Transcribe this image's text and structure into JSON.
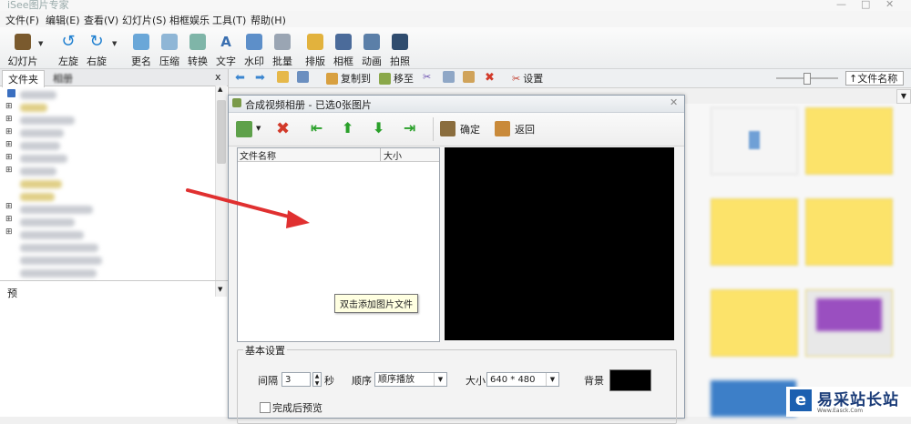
{
  "app": {
    "title": "iSee图片专家"
  },
  "menu": [
    "文件(F)",
    "编辑(E)",
    "查看(V)",
    "幻灯片(S)",
    "相框娱乐",
    "工具(T)",
    "帮助(H)"
  ],
  "toolbar": [
    "幻灯片",
    "左旋",
    "右旋",
    "更名",
    "压缩",
    "转换",
    "文字",
    "水印",
    "批量",
    "排版",
    "相框",
    "动画",
    "拍照"
  ],
  "navbar": {
    "copy_to": "复制到",
    "move_to": "移至",
    "settings": "设置",
    "sort": "↑文件名称"
  },
  "left_panel": {
    "tab_folder": "文件夹",
    "tab_album": "相册",
    "pane_close": "x",
    "preview_label": "预"
  },
  "dialog": {
    "title": "合成视频相册 - 已选0张图片",
    "toolbar": {
      "confirm": "确定",
      "back": "返回"
    },
    "file_list": {
      "col_name": "文件名称",
      "col_size": "大小"
    },
    "tooltip": "双击添加图片文件",
    "settings": {
      "group_title": "基本设置",
      "interval_label": "间隔",
      "interval_value": "3",
      "interval_unit": "秒",
      "order_label": "顺序",
      "order_value": "顺序播放",
      "size_label": "大小",
      "size_value": "640 * 480",
      "background_label": "背景",
      "preview_after": "完成后预览"
    }
  },
  "watermark": {
    "name": "易采站长站",
    "url": "Www.Easck.Com"
  },
  "colors": {
    "dialog_preview_bg": "#000000",
    "arrow": "#e03030",
    "thumb_yellow": "#fce36a"
  }
}
